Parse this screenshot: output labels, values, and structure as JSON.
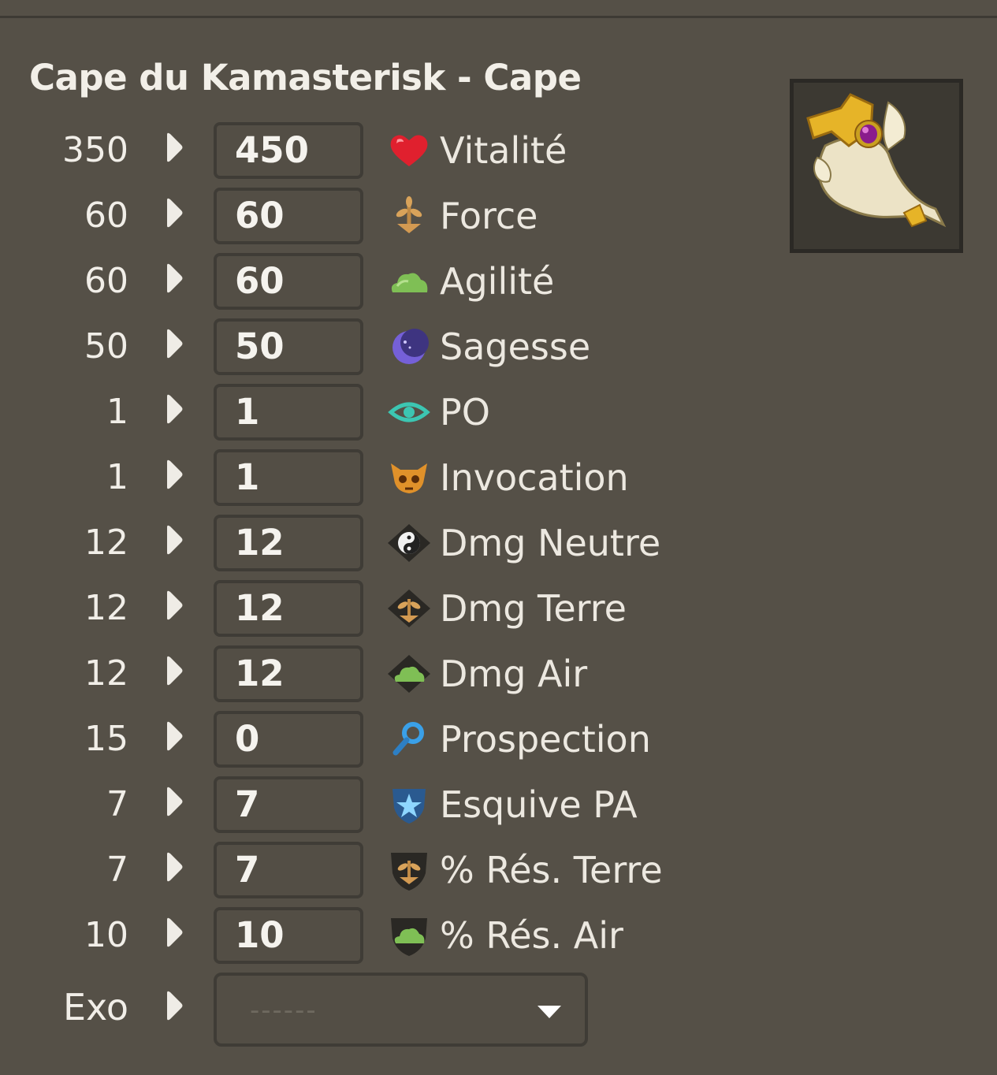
{
  "item": {
    "title": "Cape du Kamasterisk - Cape",
    "image_icon": "cape-item-icon"
  },
  "colors": {
    "background": "#555047",
    "field_border": "#3f3c36",
    "text": "#ece8e0"
  },
  "stats": [
    {
      "base": "350",
      "value": "450",
      "name": "Vitalité",
      "icon": "heart-icon"
    },
    {
      "base": "60",
      "value": "60",
      "name": "Force",
      "icon": "earth-sprout-icon"
    },
    {
      "base": "60",
      "value": "60",
      "name": "Agilité",
      "icon": "air-cloud-icon"
    },
    {
      "base": "50",
      "value": "50",
      "name": "Sagesse",
      "icon": "moon-icon"
    },
    {
      "base": "1",
      "value": "1",
      "name": "PO",
      "icon": "eye-icon"
    },
    {
      "base": "1",
      "value": "1",
      "name": "Invocation",
      "icon": "skull-icon"
    },
    {
      "base": "12",
      "value": "12",
      "name": "Dmg Neutre",
      "icon": "yin-yang-icon"
    },
    {
      "base": "12",
      "value": "12",
      "name": "Dmg Terre",
      "icon": "earth-damage-icon"
    },
    {
      "base": "12",
      "value": "12",
      "name": "Dmg Air",
      "icon": "air-damage-icon"
    },
    {
      "base": "15",
      "value": "0",
      "name": "Prospection",
      "icon": "magnifier-icon"
    },
    {
      "base": "7",
      "value": "7",
      "name": "Esquive PA",
      "icon": "star-shield-icon"
    },
    {
      "base": "7",
      "value": "7",
      "name": "% Rés. Terre",
      "icon": "earth-shield-icon"
    },
    {
      "base": "10",
      "value": "10",
      "name": "% Rés. Air",
      "icon": "air-shield-icon"
    }
  ],
  "exo": {
    "label": "Exo",
    "placeholder": "------",
    "icon": "chevron-down-icon"
  }
}
